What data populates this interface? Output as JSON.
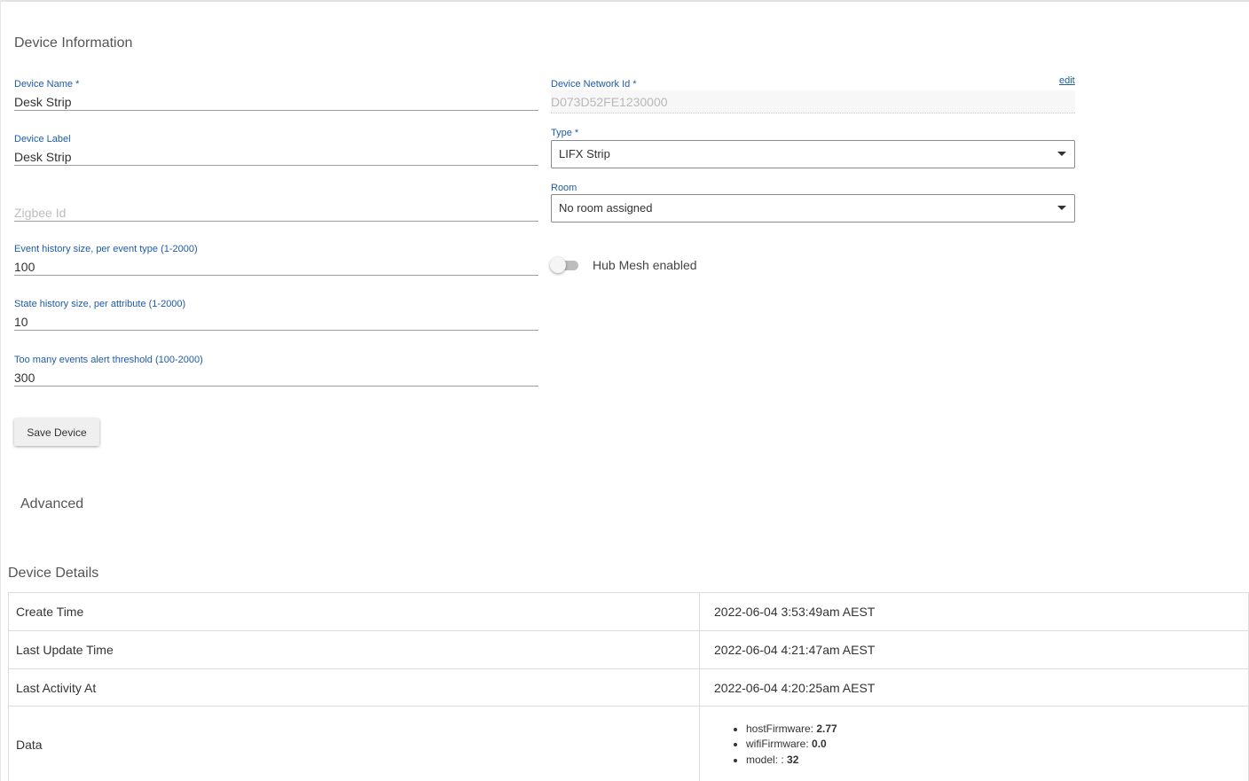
{
  "sections": {
    "device_information": "Device Information",
    "advanced": "Advanced",
    "device_details": "Device Details"
  },
  "fields": {
    "device_name": {
      "label": "Device Name *",
      "value": "Desk Strip"
    },
    "device_label": {
      "label": "Device Label",
      "value": "Desk Strip"
    },
    "zigbee_id": {
      "placeholder": "Zigbee Id",
      "value": ""
    },
    "event_history": {
      "label": "Event history size, per event type (1-2000)",
      "value": "100"
    },
    "state_history": {
      "label": "State history size, per attribute (1-2000)",
      "value": "10"
    },
    "events_threshold": {
      "label": "Too many events alert threshold (100-2000)",
      "value": "300"
    },
    "device_network_id": {
      "label": "Device Network Id *",
      "value": "D073D52FE1230000",
      "edit_label": "edit"
    },
    "type": {
      "label": "Type *",
      "value": "LIFX Strip"
    },
    "room": {
      "label": "Room",
      "value": "No room assigned"
    }
  },
  "hub_mesh": {
    "label": "Hub Mesh enabled",
    "enabled": false
  },
  "buttons": {
    "save": "Save Device"
  },
  "details": {
    "rows": [
      {
        "key": "Create Time",
        "value": "2022-06-04 3:53:49am AEST"
      },
      {
        "key": "Last Update Time",
        "value": "2022-06-04 4:21:47am AEST"
      },
      {
        "key": "Last Activity At",
        "value": "2022-06-04 4:20:25am AEST"
      }
    ],
    "data_label": "Data",
    "data_items": [
      {
        "key": "hostFirmware:",
        "value": "2.77"
      },
      {
        "key": "wifiFirmware:",
        "value": "0.0"
      },
      {
        "key": "model: :",
        "value": "32"
      }
    ]
  },
  "colors": {
    "label_blue": "#1e5ba8",
    "text": "#333333",
    "border": "#dcdcdc"
  }
}
